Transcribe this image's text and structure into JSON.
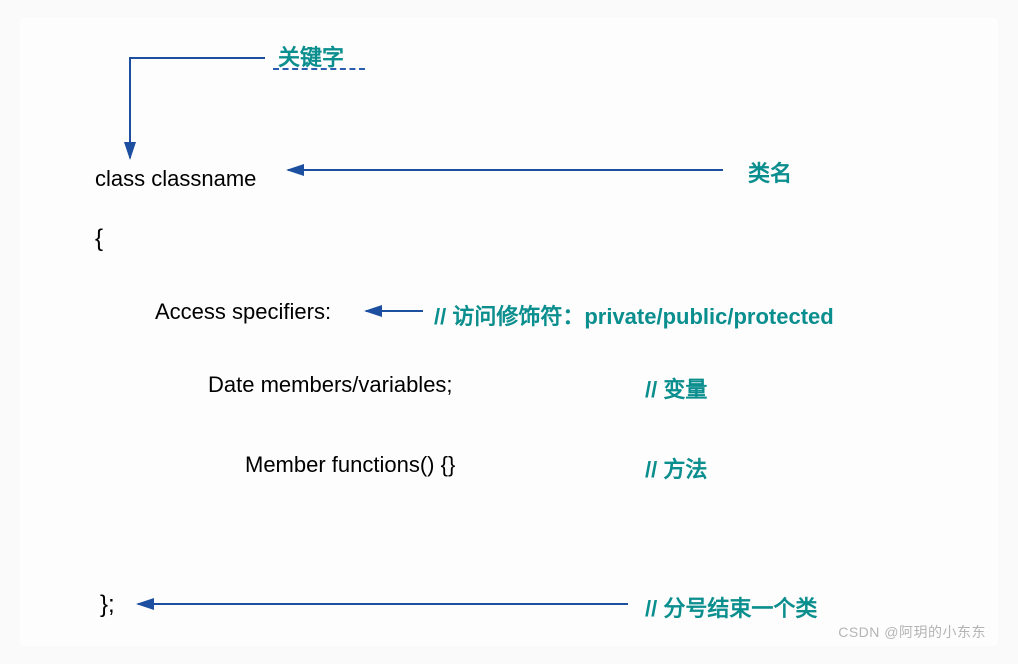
{
  "labels": {
    "keyword": "关键字",
    "classname": "类名",
    "access_comment": "// 访问修饰符：private/public/protected",
    "variable_comment": "// 变量",
    "method_comment": "// 方法",
    "semicolon_comment": "// 分号结束一个类"
  },
  "code": {
    "class_line": "class classname",
    "open_brace": "{",
    "access_line": "Access specifiers:",
    "data_line": "Date members/variables;",
    "func_line": "Member functions() {}",
    "close": "};"
  },
  "watermark": "CSDN @阿玥的小东东",
  "colors": {
    "arrow": "#1c4fa0",
    "teal": "#0b8e8e"
  }
}
